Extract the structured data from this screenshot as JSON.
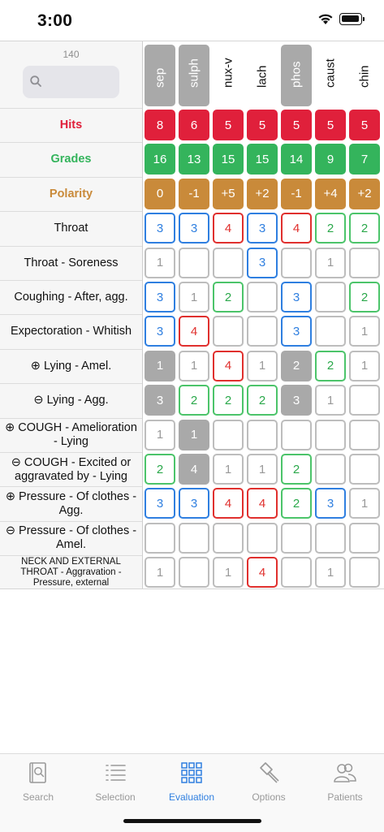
{
  "status": {
    "time": "3:00"
  },
  "header": {
    "count": "140",
    "search_placeholder": ""
  },
  "remedies": [
    {
      "name": "sep",
      "selected": true
    },
    {
      "name": "sulph",
      "selected": true
    },
    {
      "name": "nux-v",
      "selected": false
    },
    {
      "name": "lach",
      "selected": false
    },
    {
      "name": "phos",
      "selected": true
    },
    {
      "name": "caust",
      "selected": false
    },
    {
      "name": "chin",
      "selected": false
    }
  ],
  "summary_rows": [
    {
      "label": "Hits",
      "kind": "hits",
      "values": [
        "8",
        "6",
        "5",
        "5",
        "5",
        "5",
        "5"
      ]
    },
    {
      "label": "Grades",
      "kind": "grades",
      "values": [
        "16",
        "13",
        "15",
        "15",
        "14",
        "9",
        "7"
      ]
    },
    {
      "label": "Polarity",
      "kind": "polarity",
      "values": [
        "0",
        "-1",
        "+5",
        "+2",
        "-1",
        "+4",
        "+2"
      ]
    }
  ],
  "rubric_rows": [
    {
      "label": "Throat",
      "small": false,
      "cells": [
        {
          "v": "3",
          "g": 3
        },
        {
          "v": "3",
          "g": 3
        },
        {
          "v": "4",
          "g": 4
        },
        {
          "v": "3",
          "g": 3
        },
        {
          "v": "4",
          "g": 4
        },
        {
          "v": "2",
          "g": 2
        },
        {
          "v": "2",
          "g": 2
        }
      ]
    },
    {
      "label": "Throat - Soreness",
      "small": false,
      "cells": [
        {
          "v": "1",
          "g": 1
        },
        {
          "v": "",
          "g": 0
        },
        {
          "v": "",
          "g": 0
        },
        {
          "v": "3",
          "g": 3
        },
        {
          "v": "",
          "g": 0
        },
        {
          "v": "1",
          "g": 1
        },
        {
          "v": "",
          "g": 0
        }
      ]
    },
    {
      "label": "Coughing - After, agg.",
      "small": false,
      "cells": [
        {
          "v": "3",
          "g": 3
        },
        {
          "v": "1",
          "g": 1
        },
        {
          "v": "2",
          "g": 2
        },
        {
          "v": "",
          "g": 0
        },
        {
          "v": "3",
          "g": 3
        },
        {
          "v": "",
          "g": 0
        },
        {
          "v": "2",
          "g": 2
        }
      ]
    },
    {
      "label": "Expectoration - Whitish",
      "small": false,
      "cells": [
        {
          "v": "3",
          "g": 3
        },
        {
          "v": "4",
          "g": 4
        },
        {
          "v": "",
          "g": 0
        },
        {
          "v": "",
          "g": 0
        },
        {
          "v": "3",
          "g": 3
        },
        {
          "v": "",
          "g": 0
        },
        {
          "v": "1",
          "g": 1
        }
      ]
    },
    {
      "label": "⊕ Lying - Amel.",
      "small": false,
      "cells": [
        {
          "v": "1",
          "g": "s"
        },
        {
          "v": "1",
          "g": 1
        },
        {
          "v": "4",
          "g": 4
        },
        {
          "v": "1",
          "g": 1
        },
        {
          "v": "2",
          "g": "s"
        },
        {
          "v": "2",
          "g": 2
        },
        {
          "v": "1",
          "g": 1
        }
      ]
    },
    {
      "label": "⊖ Lying - Agg.",
      "small": false,
      "cells": [
        {
          "v": "3",
          "g": "s"
        },
        {
          "v": "2",
          "g": 2
        },
        {
          "v": "2",
          "g": 2
        },
        {
          "v": "2",
          "g": 2
        },
        {
          "v": "3",
          "g": "s"
        },
        {
          "v": "1",
          "g": 1
        },
        {
          "v": "",
          "g": 0
        }
      ]
    },
    {
      "label": "⊕ COUGH - Amelioration - Lying",
      "small": false,
      "cells": [
        {
          "v": "1",
          "g": 1
        },
        {
          "v": "1",
          "g": "s"
        },
        {
          "v": "",
          "g": 0
        },
        {
          "v": "",
          "g": 0
        },
        {
          "v": "",
          "g": 0
        },
        {
          "v": "",
          "g": 0
        },
        {
          "v": "",
          "g": 0
        }
      ]
    },
    {
      "label": "⊖ COUGH - Excited or aggravated by - Lying",
      "small": false,
      "cells": [
        {
          "v": "2",
          "g": 2
        },
        {
          "v": "4",
          "g": "s"
        },
        {
          "v": "1",
          "g": 1
        },
        {
          "v": "1",
          "g": 1
        },
        {
          "v": "2",
          "g": 2
        },
        {
          "v": "",
          "g": 0
        },
        {
          "v": "",
          "g": 0
        }
      ]
    },
    {
      "label": "⊕ Pressure - Of clothes - Agg.",
      "small": false,
      "cells": [
        {
          "v": "3",
          "g": 3
        },
        {
          "v": "3",
          "g": 3
        },
        {
          "v": "4",
          "g": 4
        },
        {
          "v": "4",
          "g": 4
        },
        {
          "v": "2",
          "g": 2
        },
        {
          "v": "3",
          "g": 3
        },
        {
          "v": "1",
          "g": 1
        }
      ]
    },
    {
      "label": "⊖ Pressure - Of clothes - Amel.",
      "small": false,
      "cells": [
        {
          "v": "",
          "g": 0
        },
        {
          "v": "",
          "g": 0
        },
        {
          "v": "",
          "g": 0
        },
        {
          "v": "",
          "g": 0
        },
        {
          "v": "",
          "g": 0
        },
        {
          "v": "",
          "g": 0
        },
        {
          "v": "",
          "g": 0
        }
      ]
    },
    {
      "label": "NECK AND EXTERNAL THROAT - Aggravation - Pressure, external",
      "small": true,
      "cells": [
        {
          "v": "1",
          "g": 1
        },
        {
          "v": "",
          "g": 0
        },
        {
          "v": "1",
          "g": 1
        },
        {
          "v": "4",
          "g": 4
        },
        {
          "v": "",
          "g": 0
        },
        {
          "v": "1",
          "g": 1
        },
        {
          "v": "",
          "g": 0
        }
      ]
    }
  ],
  "tabs": [
    {
      "label": "Search",
      "icon": "book-search-icon",
      "active": false
    },
    {
      "label": "Selection",
      "icon": "list-icon",
      "active": false
    },
    {
      "label": "Evaluation",
      "icon": "grid-icon",
      "active": true
    },
    {
      "label": "Options",
      "icon": "hammer-icon",
      "active": false
    },
    {
      "label": "Patients",
      "icon": "people-icon",
      "active": false
    }
  ],
  "colors": {
    "hits": "#e0203b",
    "grades": "#34b45c",
    "polarity": "#c98a3a",
    "selected": "#a9a9a9",
    "accent": "#2f7fe0"
  }
}
